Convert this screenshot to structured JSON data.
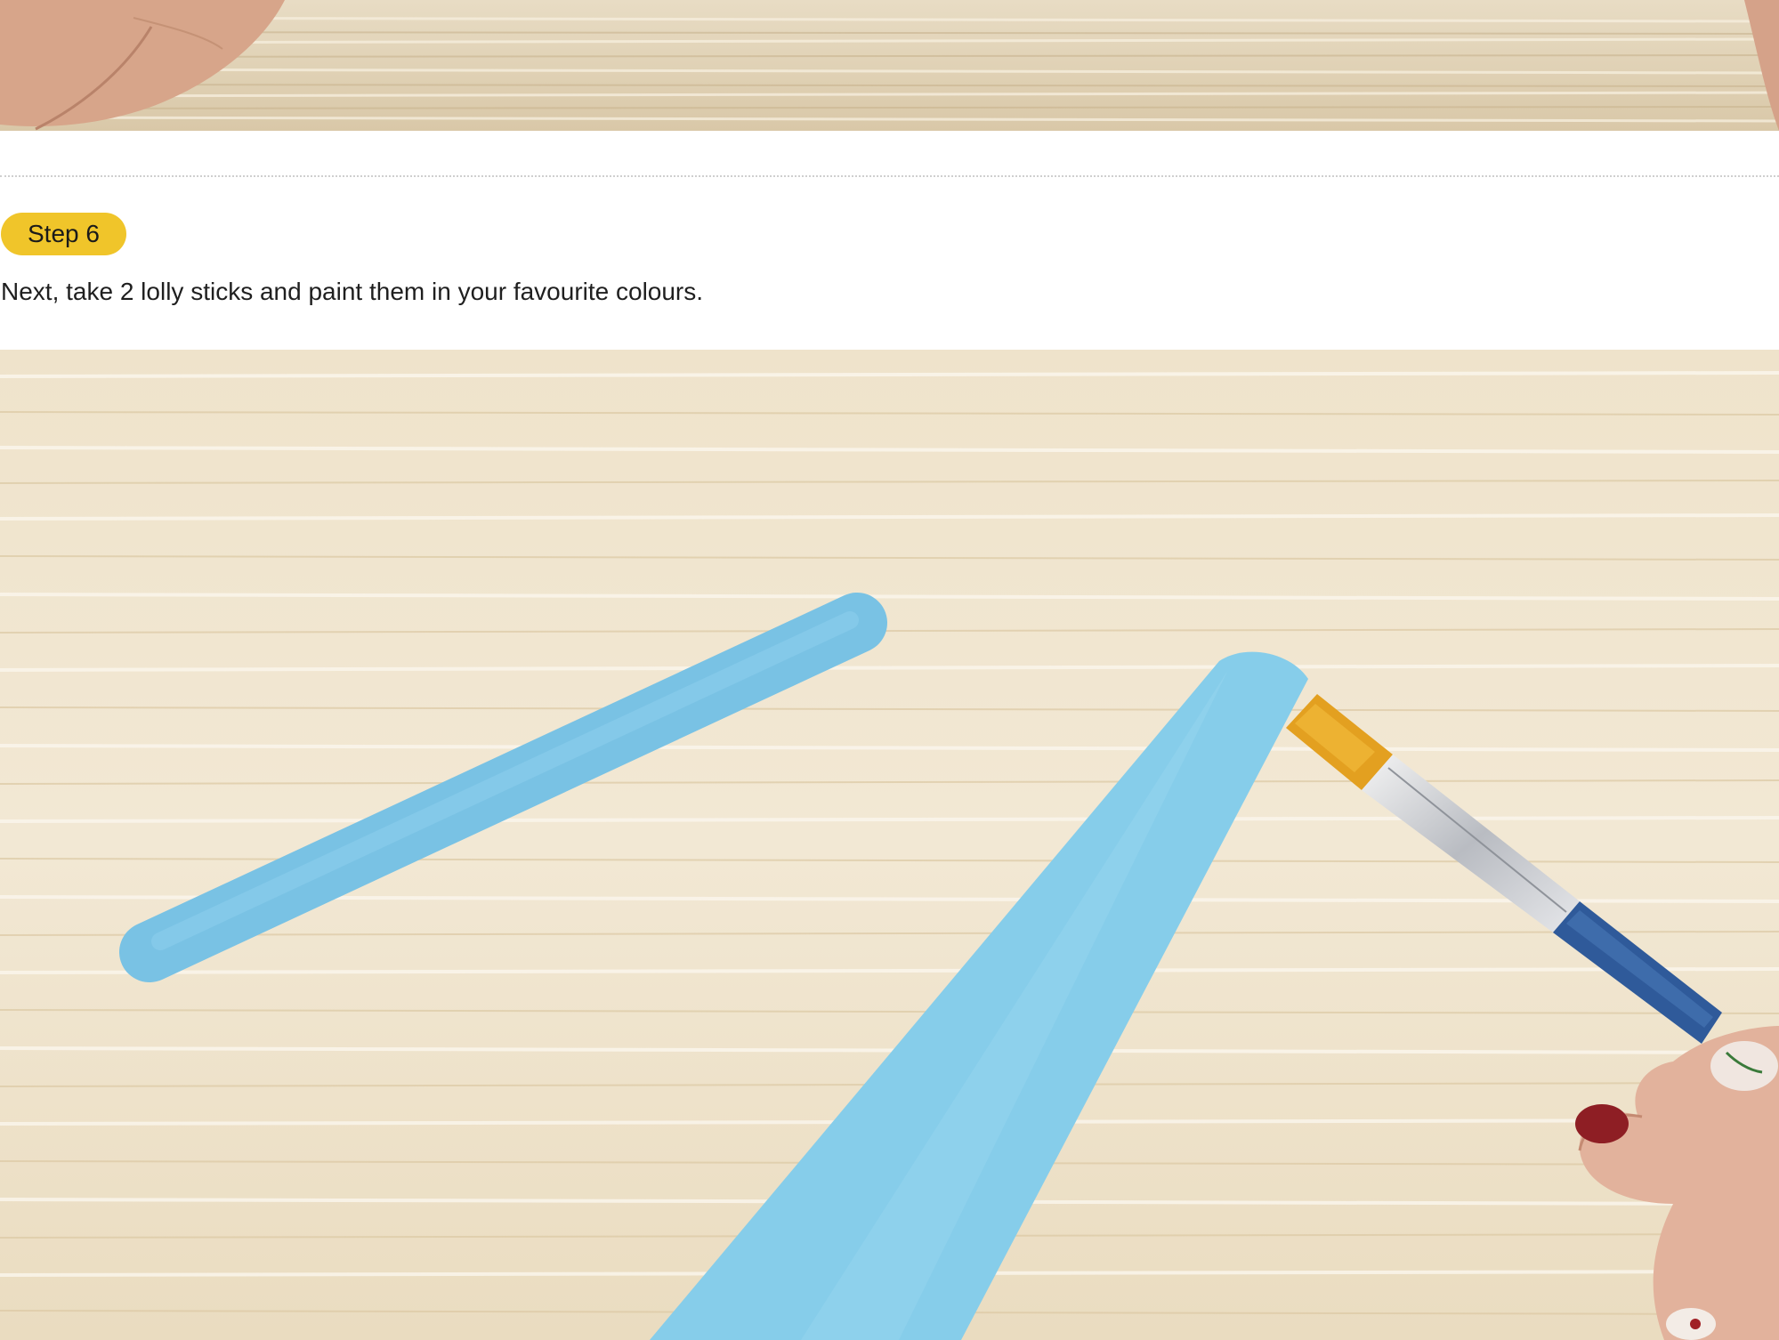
{
  "step": {
    "badge_label": "Step 6",
    "instruction": "Next, take 2 lolly sticks and paint them in your favourite colours."
  },
  "images": {
    "top_photo": "photo-top-wood-hand",
    "main_photo": "photo-painted-lolly-sticks"
  },
  "colors": {
    "badge": "#f0c52a",
    "wood": "#efe2c8",
    "stick_blue": "#7cc6e8",
    "brush_bristles": "#e6a21e",
    "brush_handle": "#2f5a9a"
  }
}
